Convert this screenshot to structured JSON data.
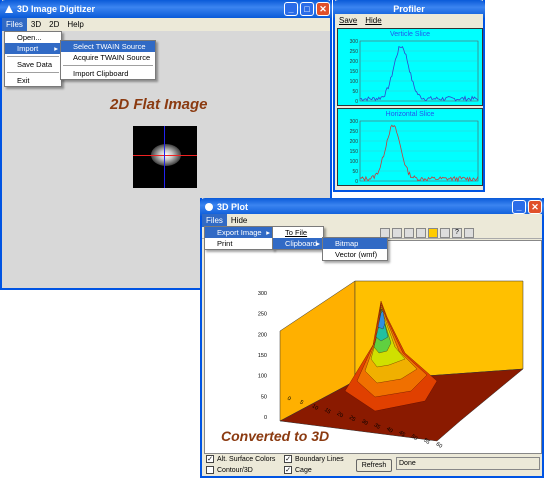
{
  "main_window": {
    "title": "3D Image Digitizer",
    "menu": [
      "Files",
      "3D",
      "2D",
      "Help"
    ],
    "files_menu": [
      "Open...",
      "Import",
      "Save Data",
      "Exit"
    ],
    "import_submenu": [
      "Select TWAIN Source",
      "Acquire TWAIN Source",
      "Import Clipboard"
    ],
    "caption": "2D Flat Image"
  },
  "profiler": {
    "title": "Profiler",
    "menu": [
      "Save",
      "Hide"
    ],
    "vertical": {
      "title": "Verticle Slice",
      "yticks": [
        "300",
        "250",
        "200",
        "150",
        "100",
        "50",
        "0"
      ]
    },
    "horizontal": {
      "title": "Horizontal Slice",
      "yticks": [
        "300",
        "250",
        "200",
        "150",
        "100",
        "50",
        "0"
      ]
    }
  },
  "plot_window": {
    "title": "3D Plot",
    "menu": [
      "Files",
      "Hide"
    ],
    "files_menu": [
      "Export Image",
      "Print"
    ],
    "export_submenu": [
      "To File",
      "Clipboard"
    ],
    "clipboard_submenu": [
      "Bitmap",
      "Vector (wmf)"
    ],
    "caption": "Converted to 3D",
    "z_ticks": [
      "300",
      "250",
      "200",
      "150",
      "100",
      "50",
      "0"
    ],
    "x_ticks": [
      "0",
      "5",
      "10",
      "15",
      "20",
      "25",
      "30",
      "35",
      "40",
      "45",
      "50",
      "55",
      "60"
    ],
    "options": {
      "alt_surface": "Alt. Surface Colors",
      "contour": "Contour/3D",
      "boundary": "Boundary Lines",
      "cage": "Cage",
      "refresh": "Refresh",
      "status": "Done"
    }
  },
  "colors": {
    "titlebar": "#0a5ad8",
    "caption": "#8b3a10",
    "profiler_bg": "#00ffff",
    "wall": "#ffc000"
  }
}
